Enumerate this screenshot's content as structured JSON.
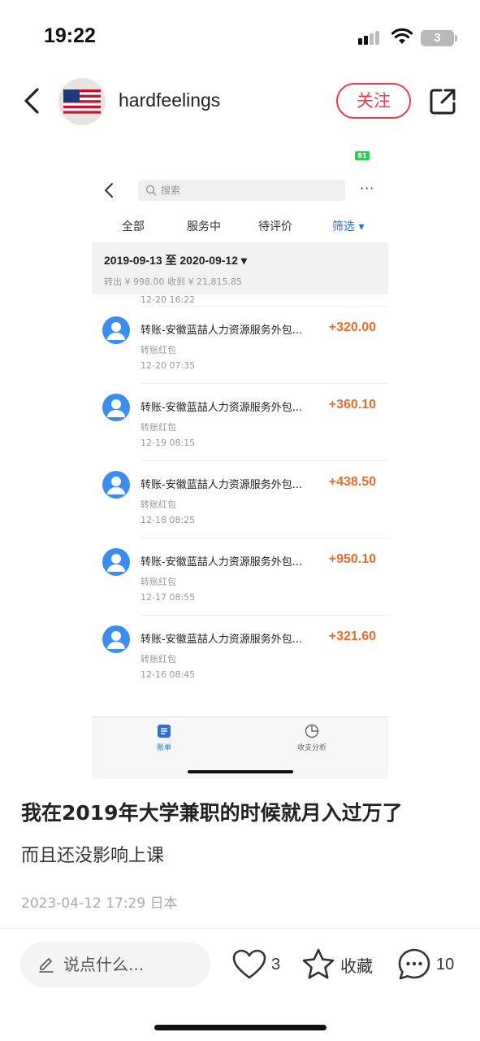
{
  "status_bar": {
    "time": "19:22",
    "battery": "3"
  },
  "header": {
    "username": "hardfeelings",
    "follow_label": "关注"
  },
  "screenshot": {
    "battery": "81",
    "search_placeholder": "搜索",
    "more": "···",
    "tabs": [
      {
        "label": "全部",
        "active": false
      },
      {
        "label": "服务中",
        "active": false
      },
      {
        "label": "待评价",
        "active": false
      },
      {
        "label": "筛选 ▾",
        "active": true
      }
    ],
    "date_range": "2019-09-13 至 2020-09-12 ▾",
    "summary": "转出 ¥ 998.00   收到 ¥ 21,815.85",
    "partial_time": "12-20  16:22",
    "transactions": [
      {
        "title": "转账-安徽蓝喆人力资源服务外包...",
        "amount": "+320.00",
        "type": "转账红包",
        "time": "12-20  07:35"
      },
      {
        "title": "转账-安徽蓝喆人力资源服务外包...",
        "amount": "+360.10",
        "type": "转账红包",
        "time": "12-19  08:15"
      },
      {
        "title": "转账-安徽蓝喆人力资源服务外包...",
        "amount": "+438.50",
        "type": "转账红包",
        "time": "12-18  08:25"
      },
      {
        "title": "转账-安徽蓝喆人力资源服务外包...",
        "amount": "+950.10",
        "type": "转账红包",
        "time": "12-17  08:55"
      },
      {
        "title": "转账-安徽蓝喆人力资源服务外包...",
        "amount": "+321.60",
        "type": "转账红包",
        "time": "12-16  08:45"
      }
    ],
    "tabbar": {
      "bills": "账单",
      "analysis": "收支分析"
    }
  },
  "post": {
    "title": "我在2019年大学兼职的时候就月入过万了",
    "body": "而且还没影响上课",
    "meta": "2023-04-12 17:29 日本"
  },
  "actions": {
    "comment_placeholder": "说点什么...",
    "likes": "3",
    "collect_label": "收藏",
    "comments": "10"
  },
  "colors": {
    "accent_red": "#ee3a4a",
    "amount_orange": "#ea6b2d",
    "link_blue": "#2a6fdb"
  }
}
